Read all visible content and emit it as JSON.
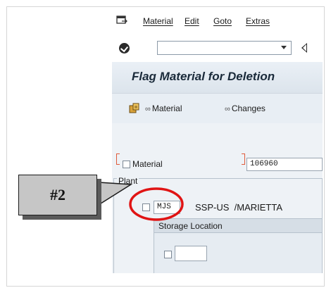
{
  "menu": {
    "icon": "menu-exit-icon",
    "items": [
      "Material",
      "Edit",
      "Goto",
      "Extras"
    ]
  },
  "toolbar": {
    "ok_icon": "checkmark-icon",
    "command_value": "",
    "back_icon": "back-triangle-icon"
  },
  "title": "Flag Material for Deletion",
  "app_toolbar": {
    "other_icon": "other-material-icon",
    "material_label": "Material",
    "changes_label": "Changes",
    "glasses_icon": "glasses-icon"
  },
  "form": {
    "material_label": "Material",
    "material_value": "106960",
    "plant_label": "Plant",
    "plant_code": "MJS",
    "plant_name": "SSP-US  /MARIETTA",
    "storage_location_label": "Storage Location",
    "storage_location_value": ""
  },
  "annotation": {
    "label": "#2",
    "circle_color": "#e01414"
  }
}
